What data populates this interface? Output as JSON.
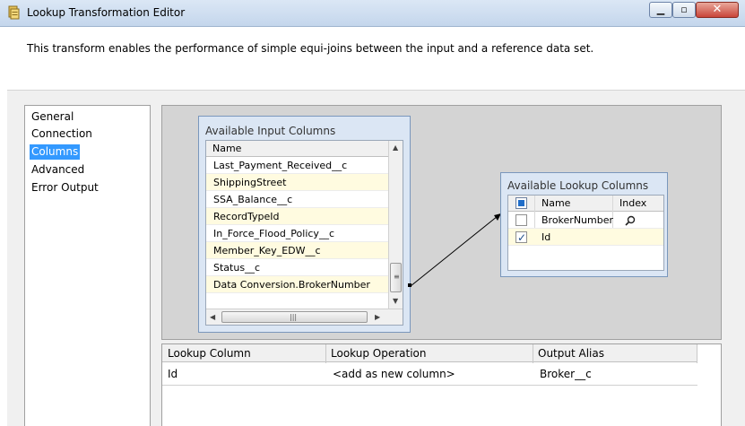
{
  "window": {
    "title": "Lookup Transformation Editor"
  },
  "description": "This transform enables the performance of simple equi-joins between the input and a reference data set.",
  "nav": {
    "items": [
      {
        "label": "General"
      },
      {
        "label": "Connection"
      },
      {
        "label": "Columns",
        "selected": true
      },
      {
        "label": "Advanced"
      },
      {
        "label": "Error Output"
      }
    ]
  },
  "input_columns": {
    "title": "Available Input Columns",
    "header_name": "Name",
    "rows": [
      "Last_Payment_Received__c",
      "ShippingStreet",
      "SSA_Balance__c",
      "RecordTypeId",
      "In_Force_Flood_Policy__c",
      "Member_Key_EDW__c",
      "Status__c",
      "Data Conversion.BrokerNumber"
    ]
  },
  "lookup_columns": {
    "title": "Available Lookup Columns",
    "header_name": "Name",
    "header_index": "Index",
    "rows": [
      {
        "name": "BrokerNumber",
        "checked": false,
        "index_icon": "search-icon"
      },
      {
        "name": "Id",
        "checked": true,
        "index_icon": ""
      }
    ]
  },
  "output_grid": {
    "headers": [
      "Lookup Column",
      "Lookup Operation",
      "Output Alias"
    ],
    "rows": [
      {
        "lookup_column": "Id",
        "operation": "<add as new column>",
        "alias": "Broker__c"
      }
    ]
  },
  "colors": {
    "selection": "#3399ff",
    "row_highlight": "#fffbe0",
    "mapping_bg": "#d4d4d4"
  }
}
